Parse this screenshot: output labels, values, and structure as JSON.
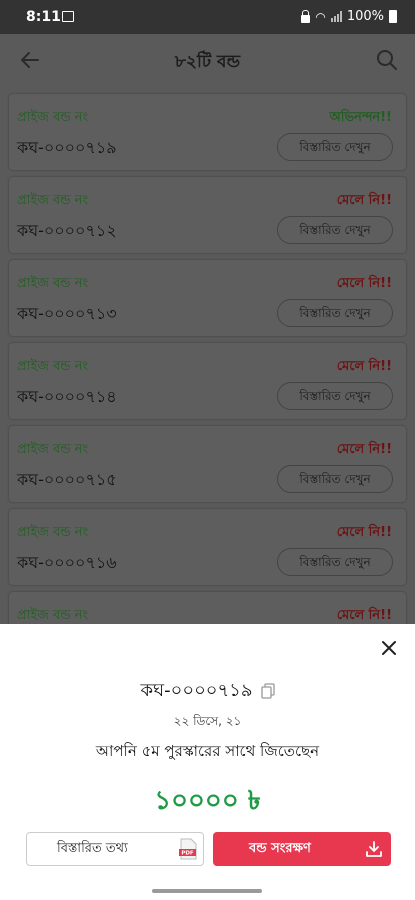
{
  "status_bar": {
    "time": "8:11",
    "battery": "100%"
  },
  "app_bar": {
    "title": "৮২টি বন্ড"
  },
  "colors": {
    "win": "#1f5f1f",
    "lose": "#6d1212",
    "amount": "#1f9a45",
    "primary_button": "#e8384f"
  },
  "bonds": [
    {
      "label": "প্রাইজ বন্ড নং",
      "number": "কঘ-০০০০৭১৯",
      "status": "অভিনন্দন!!",
      "status_type": "win",
      "detail_label": "বিস্তারিত দেখুন"
    },
    {
      "label": "প্রাইজ বন্ড নং",
      "number": "কঘ-০০০০৭১২",
      "status": "মেলে নি!!",
      "status_type": "lose",
      "detail_label": "বিস্তারিত দেখুন"
    },
    {
      "label": "প্রাইজ বন্ড নং",
      "number": "কঘ-০০০০৭১৩",
      "status": "মেলে নি!!",
      "status_type": "lose",
      "detail_label": "বিস্তারিত দেখুন"
    },
    {
      "label": "প্রাইজ বন্ড নং",
      "number": "কঘ-০০০০৭১৪",
      "status": "মেলে নি!!",
      "status_type": "lose",
      "detail_label": "বিস্তারিত দেখুন"
    },
    {
      "label": "প্রাইজ বন্ড নং",
      "number": "কঘ-০০০০৭১৫",
      "status": "মেলে নি!!",
      "status_type": "lose",
      "detail_label": "বিস্তারিত দেখুন"
    },
    {
      "label": "প্রাইজ বন্ড নং",
      "number": "কঘ-০০০০৭১৬",
      "status": "মেলে নি!!",
      "status_type": "lose",
      "detail_label": "বিস্তারিত দেখুন"
    },
    {
      "label": "প্রাইজ বন্ড নং",
      "number": "",
      "status": "মেলে নি!!",
      "status_type": "lose",
      "detail_label": ""
    }
  ],
  "sheet": {
    "bond_number": "কঘ-০০০০৭১৯",
    "date": "২২ ডিসে, ২১",
    "message": "আপনি ৫ম পুরস্কারের সাথে জিতেছেন",
    "amount": "১০০০০ ৳",
    "info_button": "বিস্তারিত তথ্য",
    "save_button": "বন্ড সংরক্ষণ"
  }
}
